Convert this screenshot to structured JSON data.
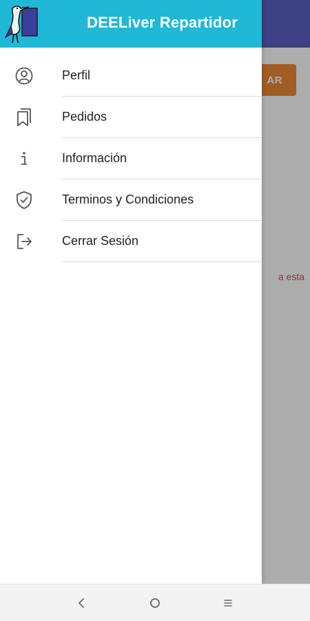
{
  "app": {
    "title": "DEELiver Repartidor",
    "colors": {
      "header": "#1fb8d6",
      "appbar": "#5a5fc0",
      "accent_button": "#ec8a36",
      "error_text": "#e3485a"
    }
  },
  "background": {
    "button_label": "AR",
    "error_text": "a esta"
  },
  "menu": {
    "items": [
      {
        "label": "Perfil",
        "icon": "account-circle-icon"
      },
      {
        "label": "Pedidos",
        "icon": "bookmarks-icon"
      },
      {
        "label": "Información",
        "icon": "info-icon"
      },
      {
        "label": "Terminos y Condiciones",
        "icon": "shield-check-icon"
      },
      {
        "label": "Cerrar Sesión",
        "icon": "logout-icon"
      }
    ]
  },
  "system_nav": {
    "buttons": [
      "back-icon",
      "home-icon",
      "menu-lines-icon"
    ]
  }
}
